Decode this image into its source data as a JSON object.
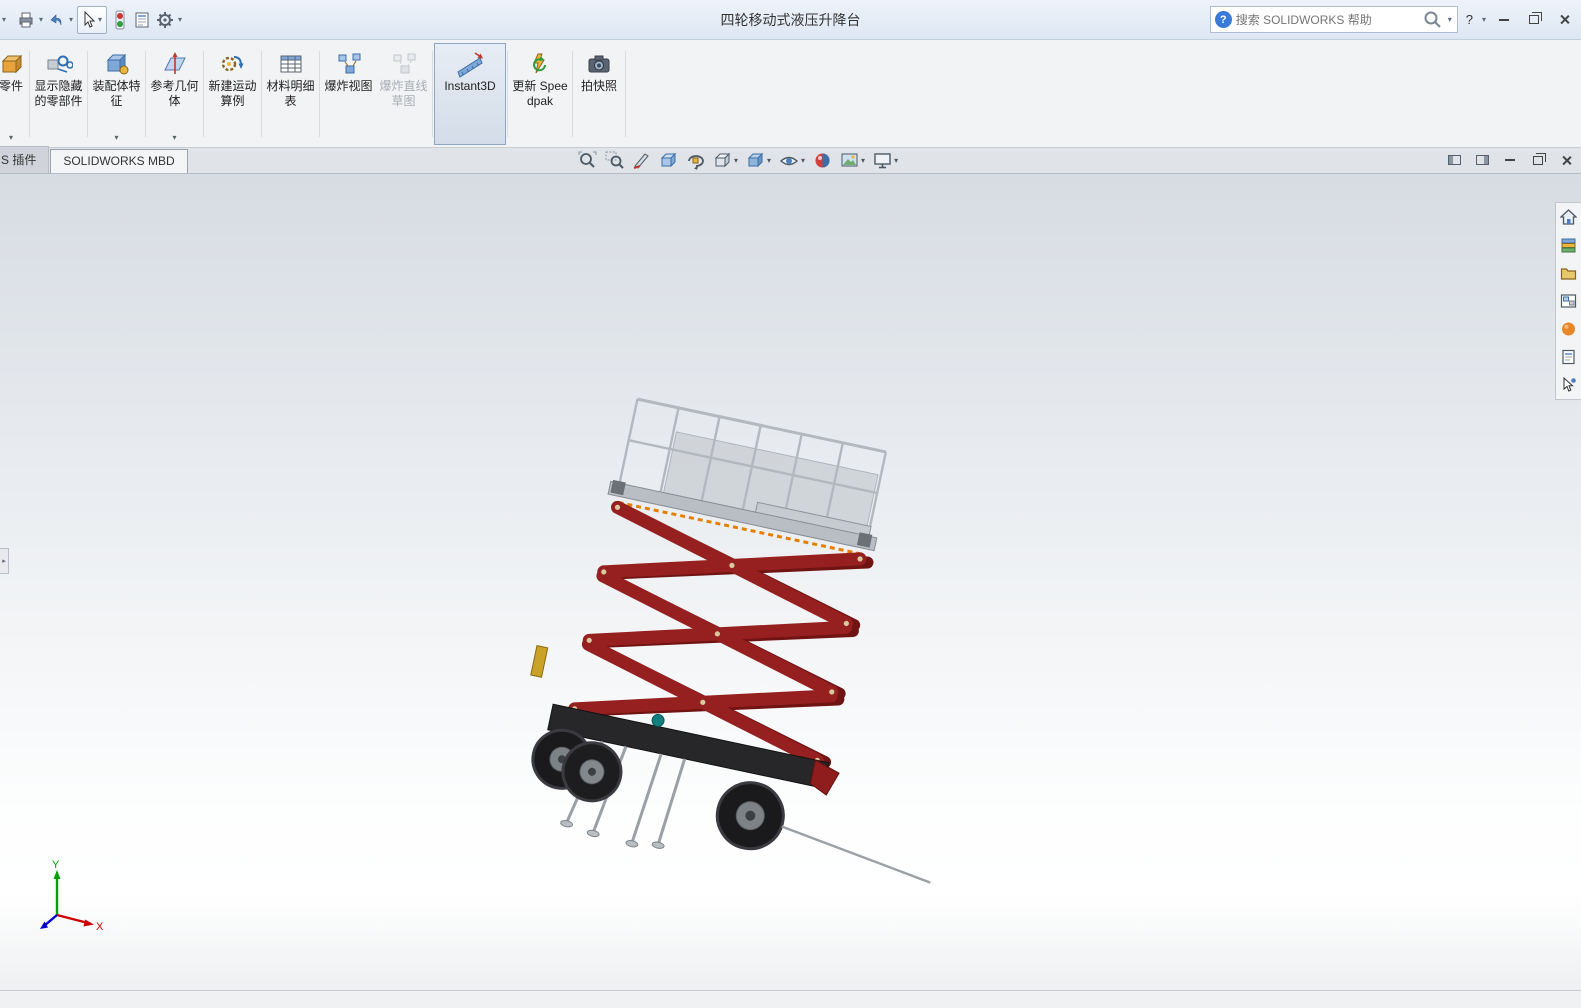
{
  "titlebar": {
    "title": "四轮移动式液压升降台",
    "help_label": "?",
    "search": {
      "placeholder": "搜索 SOLIDWORKS 帮助",
      "help_badge": "?"
    }
  },
  "ribbon": {
    "buttons": [
      {
        "label": "零件"
      },
      {
        "label": "显示隐藏的零部件"
      },
      {
        "label": "装配体特征"
      },
      {
        "label": "参考几何体"
      },
      {
        "label": "新建运动算例"
      },
      {
        "label": "材料明细表"
      },
      {
        "label": "爆炸视图"
      },
      {
        "label": "爆炸直线草图"
      },
      {
        "label": "Instant3D"
      },
      {
        "label": "更新 Speedpak"
      },
      {
        "label": "拍快照"
      }
    ]
  },
  "command_tabs": [
    {
      "label": "S 插件"
    },
    {
      "label": "SOLIDWORKS MBD"
    }
  ],
  "view_toolbar": {
    "icons": [
      "zoom-fit",
      "zoom-area",
      "section-view",
      "view-selector",
      "rotate-view",
      "view-orientation",
      "display-style",
      "hide-show-items",
      "edit-appearance",
      "apply-scene",
      "view-settings"
    ]
  },
  "task_pane": {
    "icons": [
      "solidworks-resources",
      "design-library",
      "file-explorer",
      "view-palette",
      "appearances-scenes",
      "custom-properties",
      "solidworks-forum"
    ]
  },
  "viewport": {
    "triad": {
      "x_label": "X",
      "y_label": "Y"
    }
  },
  "colors": {
    "accent_blue": "#2f6fb4",
    "scissor_red": "#8f1d1d",
    "dash_orange": "#e57f00",
    "chassis_black": "#27272a"
  }
}
